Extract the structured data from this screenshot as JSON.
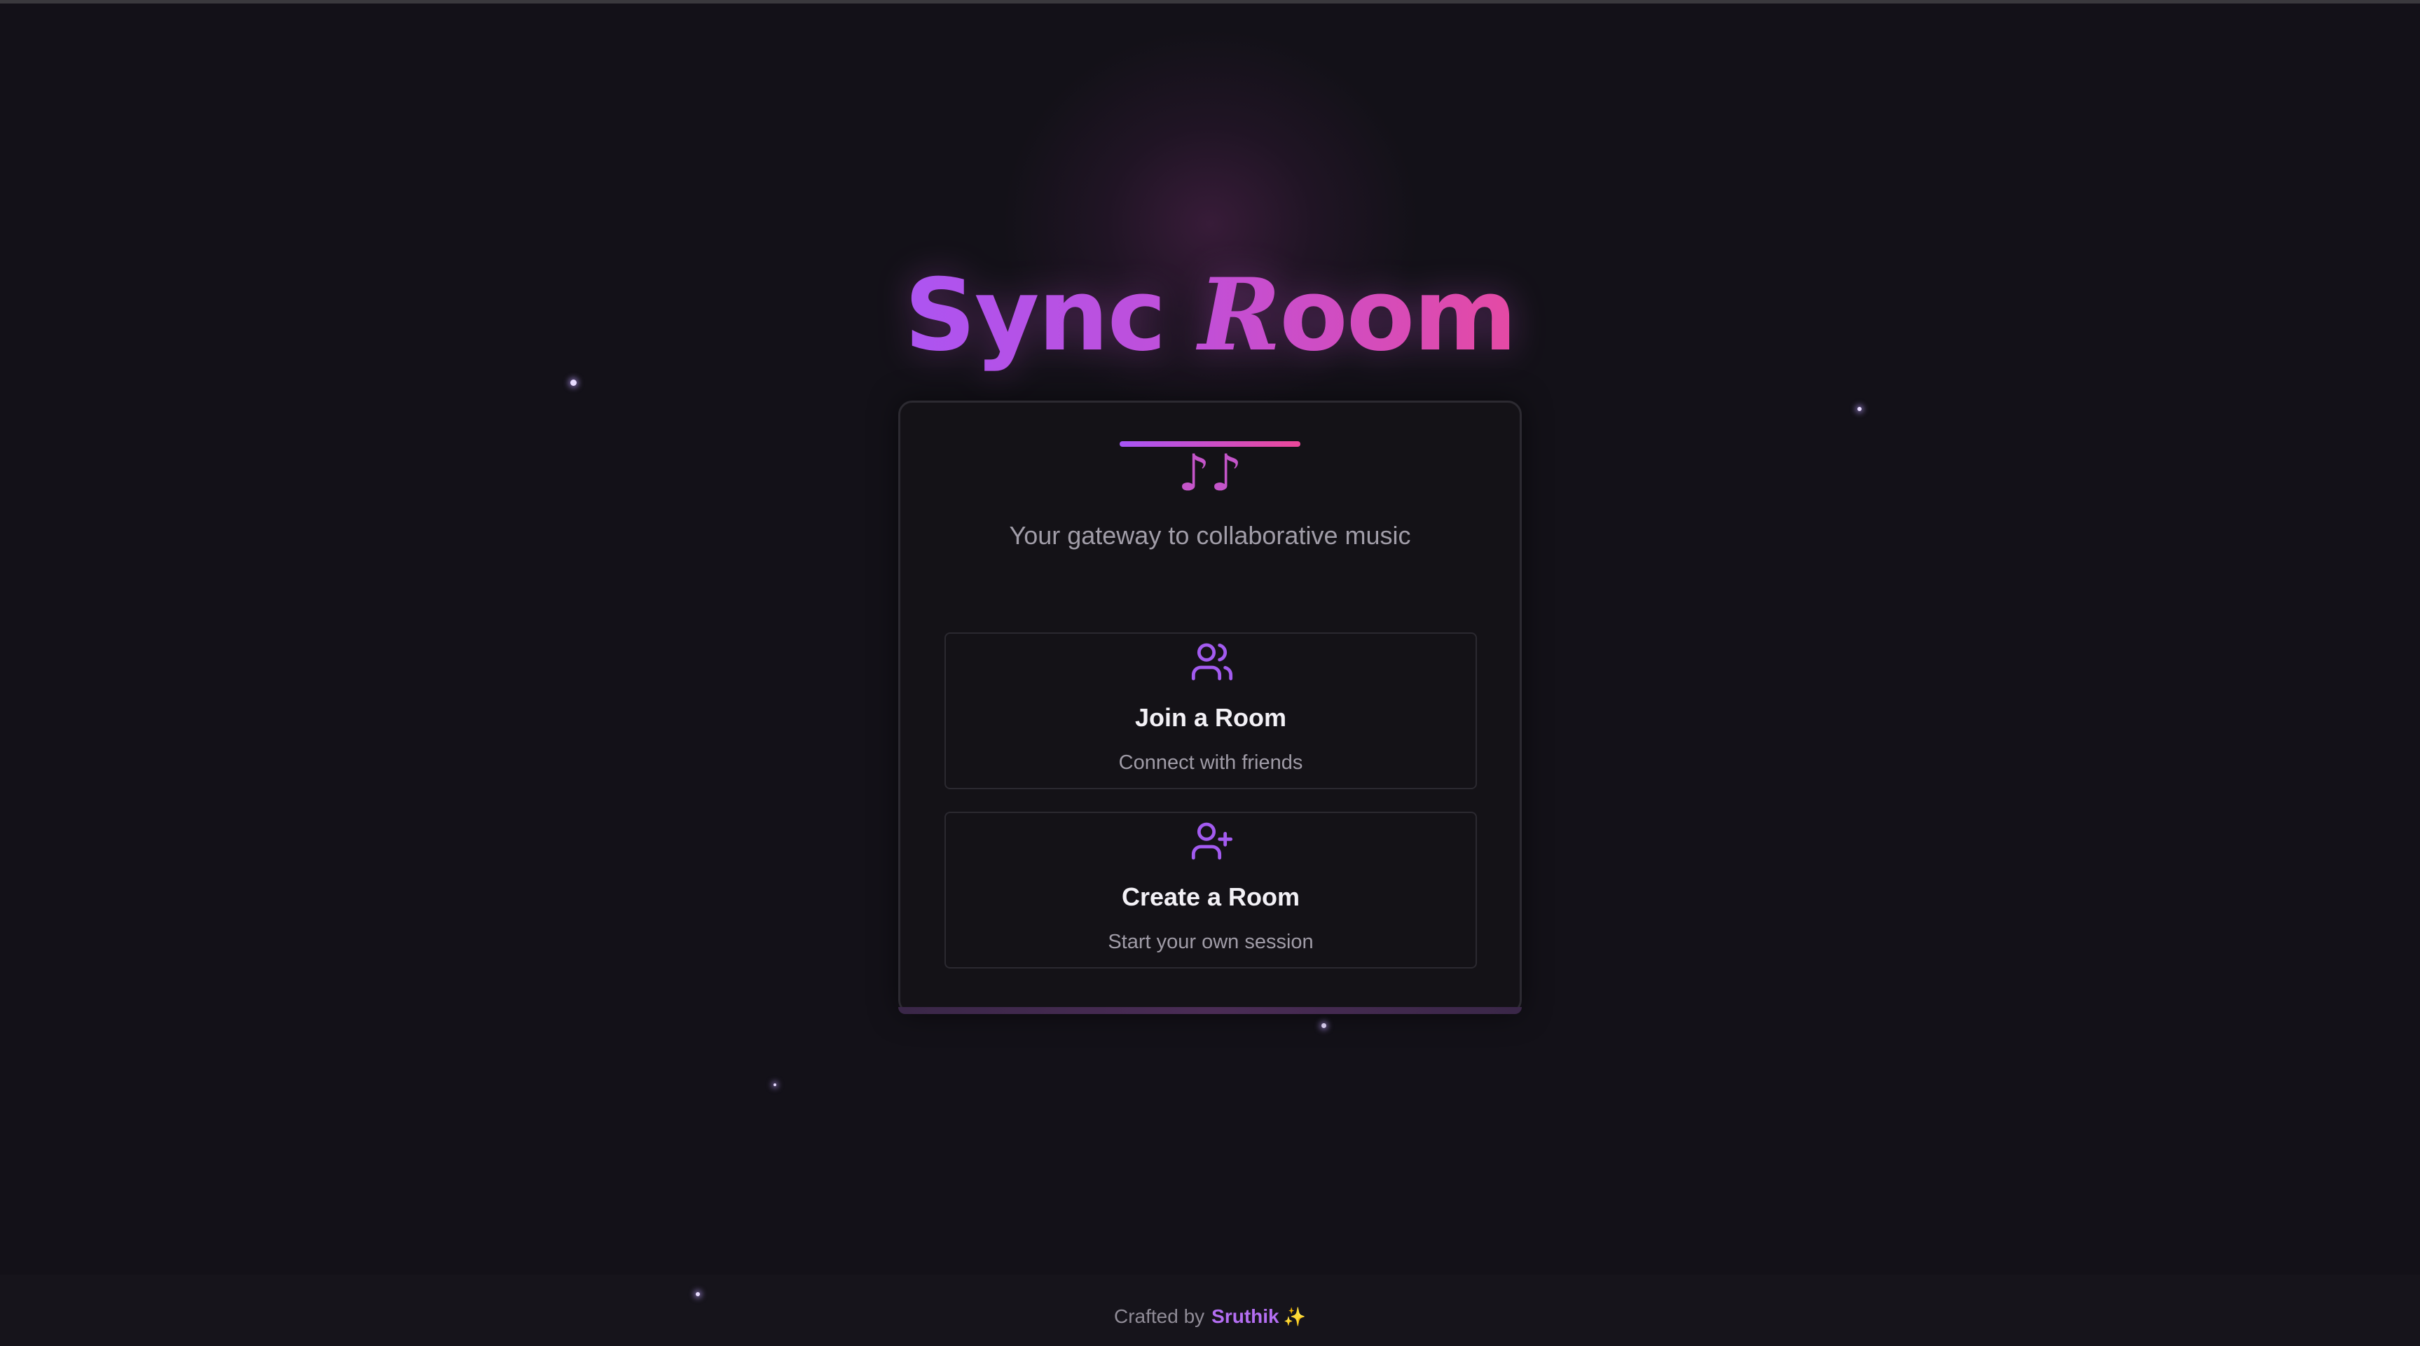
{
  "app": {
    "title_part1": "Sync ",
    "title_script": "R",
    "title_part2": "oom",
    "tagline": "Your gateway to collaborative music"
  },
  "header_icon": "♪♪",
  "options": [
    {
      "icon": "users-icon",
      "label": "Join a Room",
      "subtitle": "Connect with friends"
    },
    {
      "icon": "user-plus-icon",
      "label": "Create a Room",
      "subtitle": "Start your own session"
    }
  ],
  "footer": {
    "prefix": "Crafted by",
    "author": "Sruthik",
    "sparkle": "✨"
  },
  "colors": {
    "background": "#131118",
    "accent_purple": "#a855f7",
    "accent_pink": "#ec4899",
    "icon_purple": "#a35bf0",
    "text_muted": "#a19da8"
  }
}
